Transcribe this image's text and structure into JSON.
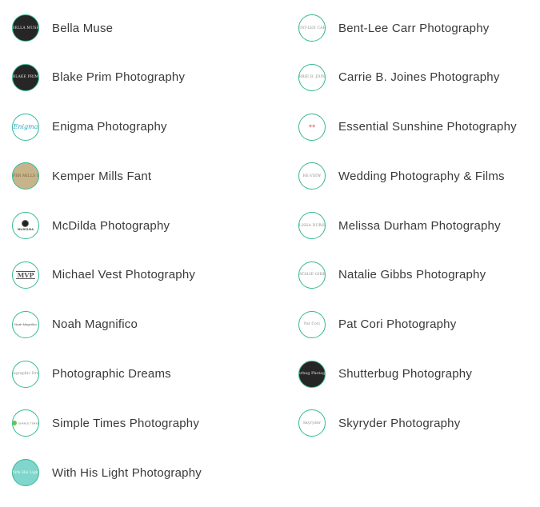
{
  "colors": {
    "avatar_border": "#35b895",
    "label_text": "#3a3a3a",
    "background": "#ffffff"
  },
  "vendors_left": [
    {
      "name": "Bella Muse",
      "logo_text": "BELLA MUSE",
      "logo_style": "dark"
    },
    {
      "name": "Blake Prim Photography",
      "logo_text": "BLAKE PRIM",
      "logo_style": "dark"
    },
    {
      "name": "Enigma Photography",
      "logo_text": "Enigma",
      "logo_style": "script-blue"
    },
    {
      "name": "Kemper Mills Fant",
      "logo_text": "KEMPER MILLS FANT",
      "logo_style": "tan"
    },
    {
      "name": "McDilda Photography",
      "logo_text": "McDILDA",
      "logo_style": "camera"
    },
    {
      "name": "Michael Vest Photography",
      "logo_text": "MVP",
      "logo_style": "serif-bold"
    },
    {
      "name": "Noah Magnifico",
      "logo_text": "Noah Magnifico",
      "logo_style": "small-blue"
    },
    {
      "name": "Photographic Dreams",
      "logo_text": "Photographic Dreams",
      "logo_style": "light"
    },
    {
      "name": "Simple Times Photography",
      "logo_text": "SIMPLE TIMES",
      "logo_style": "green-dot"
    },
    {
      "name": "With His Light Photography",
      "logo_text": "With His Light",
      "logo_style": "teal"
    }
  ],
  "vendors_right": [
    {
      "name": "Bent-Lee Carr Photography",
      "logo_text": "BENT-LEE CARR",
      "logo_style": "light"
    },
    {
      "name": "Carrie B. Joines Photography",
      "logo_text": "CARRIE B. JOINES",
      "logo_style": "light"
    },
    {
      "name": "Essential Sunshine Photography",
      "logo_text": "♥♥",
      "logo_style": "hearts"
    },
    {
      "name": "Wedding Photography & Films",
      "logo_text": "RE:VIEW",
      "logo_style": "light"
    },
    {
      "name": "Melissa Durham Photography",
      "logo_text": "MELISSA DURHAM",
      "logo_style": "light"
    },
    {
      "name": "Natalie Gibbs Photography",
      "logo_text": "NATALIE GIBBS",
      "logo_style": "light"
    },
    {
      "name": "Pat Cori Photography",
      "logo_text": "Pat Cori",
      "logo_style": "light"
    },
    {
      "name": "Shutterbug Photography",
      "logo_text": "Shutterbug Photography",
      "logo_style": "dark"
    },
    {
      "name": "Skyryder Photography",
      "logo_text": "Skyryder",
      "logo_style": "light"
    }
  ]
}
